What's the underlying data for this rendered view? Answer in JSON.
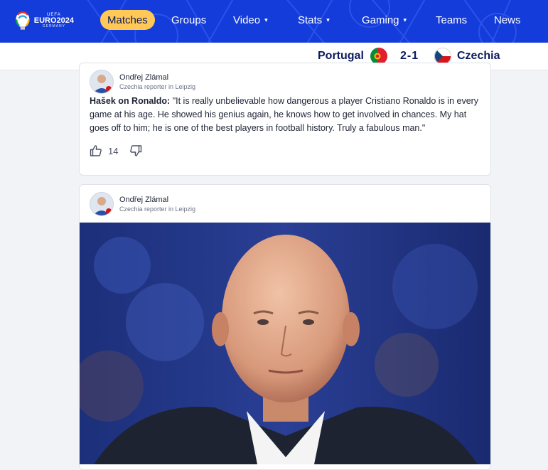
{
  "nav": {
    "logo": {
      "uefa": "UEFA",
      "euro": "EURO2024",
      "host": "GERMANY"
    },
    "items": [
      {
        "label": "Matches",
        "active": true,
        "dropdown": false
      },
      {
        "label": "Groups",
        "active": false,
        "dropdown": false
      },
      {
        "label": "Video",
        "active": false,
        "dropdown": true
      },
      {
        "label": "Stats",
        "active": false,
        "dropdown": true
      },
      {
        "label": "Gaming",
        "active": false,
        "dropdown": true
      },
      {
        "label": "Teams",
        "active": false,
        "dropdown": false
      },
      {
        "label": "News",
        "active": false,
        "dropdown": false
      }
    ],
    "caret": "▾"
  },
  "scorebar": {
    "home": "Portugal",
    "away": "Czechia",
    "score": "2-1"
  },
  "posts": [
    {
      "author": "Ondřej Zlámal",
      "role": "Czechia reporter in Leipzig",
      "speaker": "Hašek on Ronaldo:",
      "text": " \"It is really unbelievable how dangerous a player Cristiano Ronaldo is in every game at his age. He showed his genius again, he knows how to get involved in chances. My hat goes off to him; he is one of the best players in football history. Truly a fabulous man.\"",
      "likes": "14"
    },
    {
      "author": "Ondřej Zlámal",
      "role": "Czechia reporter in Leipzig"
    }
  ],
  "icons": {
    "like": "thumbs-up-icon",
    "dislike": "thumbs-down-icon"
  },
  "colors": {
    "nav_bg": "#143cdb",
    "active_pill": "#ffc857",
    "text_dark": "#0b1a5c"
  }
}
